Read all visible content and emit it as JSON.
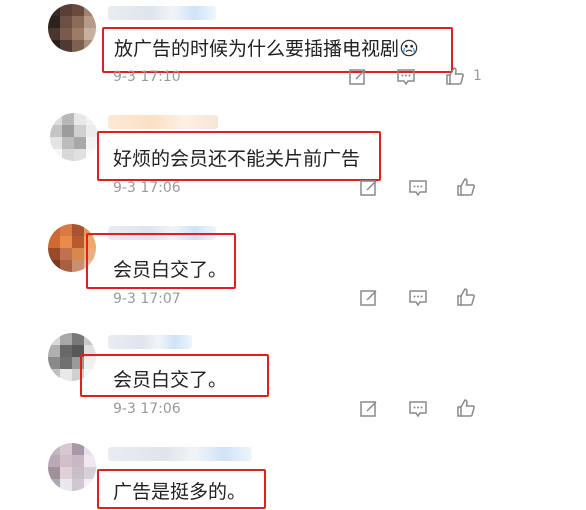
{
  "comments": [
    {
      "text": "放广告的时候为什么要插播电视剧",
      "emoji_icon": "crying-face-emoji",
      "time": "9-3 17:10",
      "like_count": "1",
      "avatar_colors": [
        "#3a2a26",
        "#5a3f36",
        "#6b4a3e",
        "#a08070",
        "#2e221f",
        "#6d5045",
        "#8a6a58",
        "#b89a88",
        "#4a3630",
        "#7a5a4a",
        "#9c7c68",
        "#c8b0a0",
        "#2a201c",
        "#4e3a32",
        "#7c6050",
        "#a8907e"
      ]
    },
    {
      "text": "好烦的会员还不能关片前广告",
      "time": "9-3 17:06",
      "like_count": "",
      "avatar_colors": [
        "#dcdcdc",
        "#b8b8b8",
        "#e8e8e8",
        "#f2f2f2",
        "#c4c4c4",
        "#9c9c9c",
        "#d0d0d0",
        "#ececec",
        "#e4e4e4",
        "#bcbcbc",
        "#a8a8a8",
        "#f4f4f4",
        "#f6f6f6",
        "#d8d8d8",
        "#e0e0e0",
        "#fafafa"
      ]
    },
    {
      "text": "会员白交了。",
      "time": "9-3 17:07",
      "like_count": "",
      "avatar_colors": [
        "#c86a3a",
        "#d87a42",
        "#a85430",
        "#e09a60",
        "#d06a30",
        "#e88a48",
        "#b85a2c",
        "#f0a868",
        "#9a4a2a",
        "#c07050",
        "#d8884a",
        "#e8b080",
        "#7a3a22",
        "#a86040",
        "#c89070",
        "#e0c0a0"
      ]
    },
    {
      "text": "会员白交了。",
      "time": "9-3 17:06",
      "like_count": "",
      "avatar_colors": [
        "#d8d8d8",
        "#a8a8a8",
        "#787878",
        "#c8c8c8",
        "#b0b0b0",
        "#686868",
        "#585858",
        "#e0e0e0",
        "#8a8a8a",
        "#707070",
        "#9a9a9a",
        "#f0f0f0",
        "#c0c0c0",
        "#e8e8e8",
        "#d0d0d0",
        "#f8f8f8"
      ]
    },
    {
      "text": "广告是挺多的。",
      "time": "",
      "like_count": "",
      "avatar_colors": [
        "#c0b8c0",
        "#d8c8d0",
        "#a898a8",
        "#e8e0e8",
        "#b8a8b8",
        "#d0c0c8",
        "#c8b8c4",
        "#f0e8f0",
        "#a09098",
        "#e0d0d8",
        "#c8c0c8",
        "#d8d0d8",
        "#b0a8b0",
        "#e8e8ec",
        "#d0c8d0",
        "#f4f0f4"
      ]
    }
  ],
  "colors": {
    "highlight_border": "#e02020",
    "time_text": "#9a9a9a",
    "body_text": "#222222"
  },
  "icons": {
    "edit": "edit-icon",
    "reply": "comment-icon",
    "like": "thumbs-up-icon"
  }
}
